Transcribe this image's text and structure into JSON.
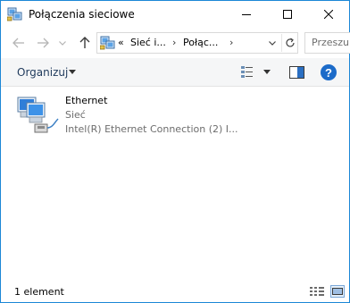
{
  "window": {
    "title": "Połączenia sieciowe",
    "accent_color": "#1c87d6"
  },
  "navigation": {
    "back_icon": "arrow-left-icon",
    "forward_icon": "arrow-right-icon",
    "recent_icon": "chevron-down-icon",
    "up_icon": "arrow-up-icon"
  },
  "address": {
    "overflow": "«",
    "segments": [
      "Sieć i...",
      "Połąc..."
    ],
    "refresh_icon": "refresh-icon"
  },
  "search": {
    "placeholder": "Przeszu"
  },
  "toolbar": {
    "organize_label": "Organizuj",
    "help_label": "?"
  },
  "connections": [
    {
      "name": "Ethernet",
      "status": "Sieć",
      "device": "Intel(R) Ethernet Connection (2) I...",
      "icon": "network-adapter-icon"
    }
  ],
  "statusbar": {
    "item_count": "1 element"
  }
}
